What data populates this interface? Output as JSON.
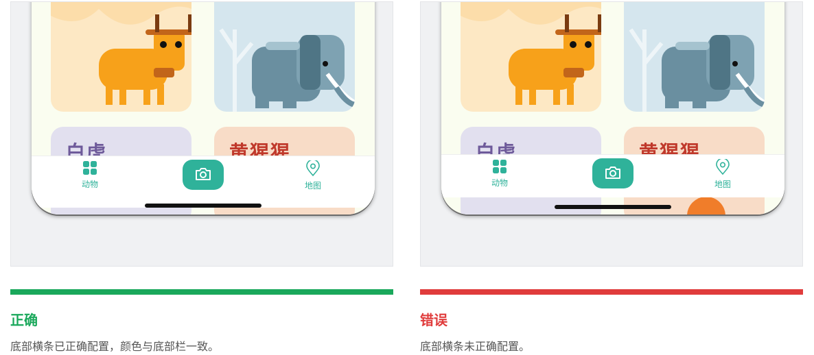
{
  "colors": {
    "correct": "#1aa85b",
    "incorrect": "#e03c3c",
    "teal": "#2fb29a"
  },
  "left_phone": {
    "card_labels": [
      "白虎",
      "黄猩猩"
    ],
    "tabs": {
      "animals": "动物",
      "map": "地图"
    },
    "camera_icon": "camera-icon"
  },
  "right_phone": {
    "card_labels": [
      "白虎",
      "黄猩猩"
    ],
    "tabs": {
      "animals": "动物",
      "map": "地图"
    },
    "camera_icon": "camera-icon"
  },
  "correct": {
    "title": "正确",
    "description": "底部横条已正确配置，颜色与底部栏一致。"
  },
  "incorrect": {
    "title": "错误",
    "description": "底部横条未正确配置。"
  }
}
